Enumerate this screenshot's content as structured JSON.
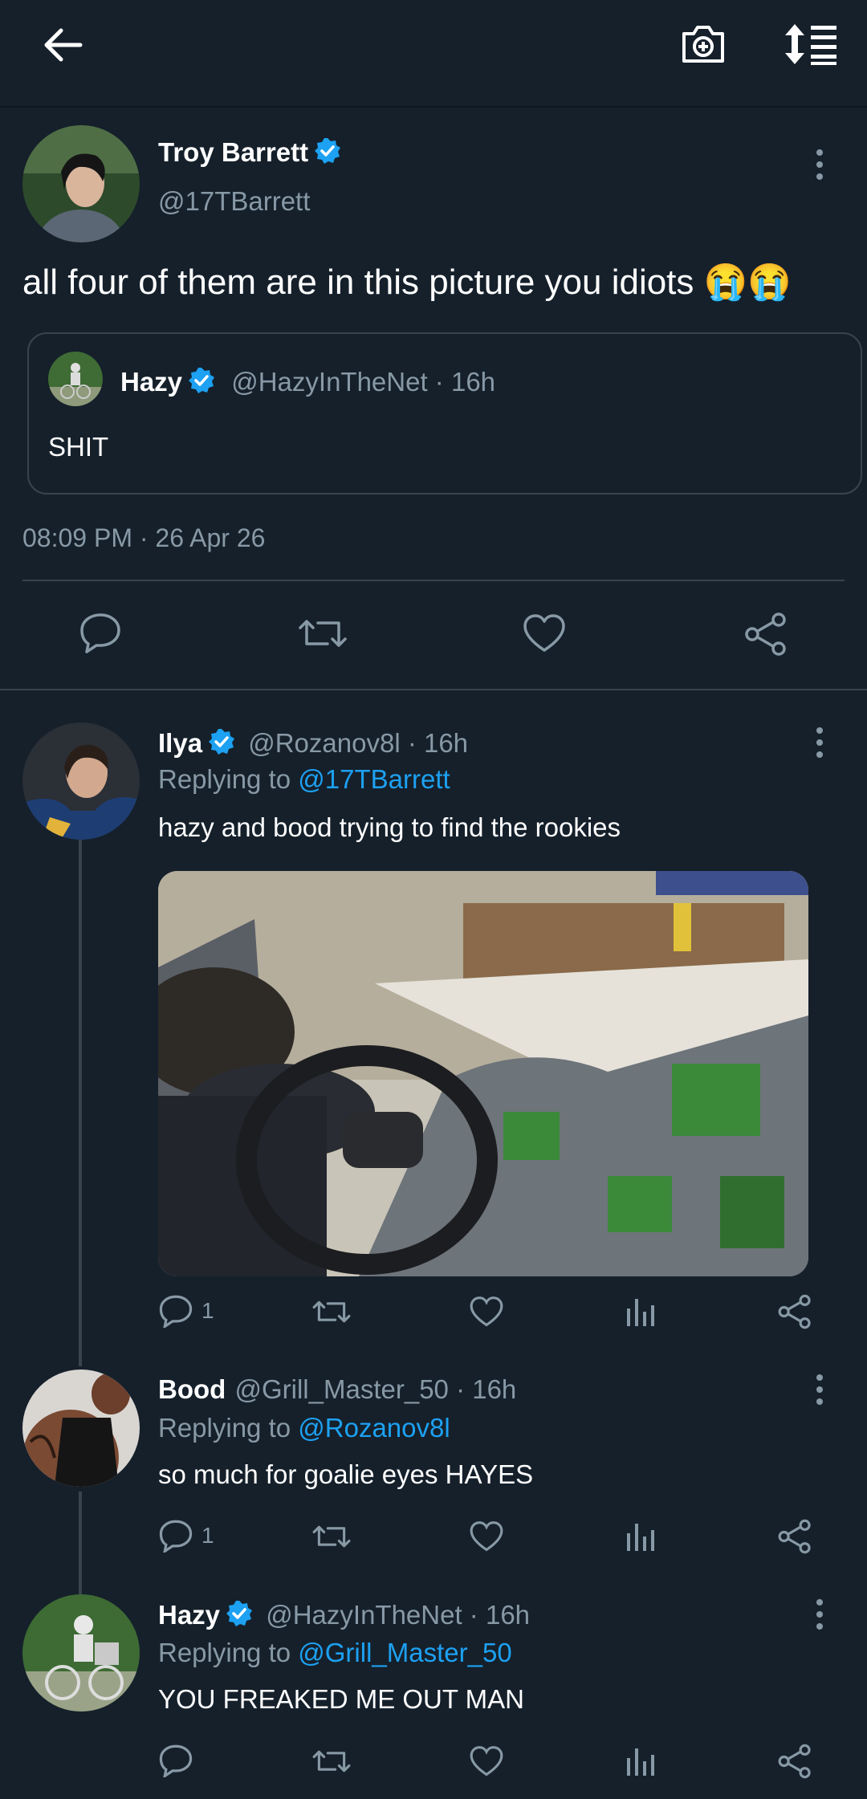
{
  "topbar": {
    "back_icon": "arrow-left-icon",
    "camera_icon": "camera-plus-icon",
    "sort_icon": "sort-list-icon"
  },
  "main_tweet": {
    "author_name": "Troy Barrett",
    "handle": "@17TBarrett",
    "text": "all four of them are in this picture you idiots 😭😭",
    "quote": {
      "author_name": "Hazy",
      "handle_time": "@HazyInTheNet · 16h",
      "text": "SHIT"
    },
    "timestamp": "08:09 PM · 26 Apr 26"
  },
  "replies": [
    {
      "author_name": "Ilya",
      "verified": true,
      "handle_time": "@Rozanov8l · 16h",
      "replying_prefix": "Replying to ",
      "replying_to": "@17TBarrett",
      "text": "hazy and bood trying to find the rookies",
      "reply_count": "1"
    },
    {
      "author_name": "Bood",
      "verified": false,
      "handle_time": "@Grill_Master_50 · 16h",
      "replying_prefix": "Replying to ",
      "replying_to": "@Rozanov8l",
      "text": "so much for goalie eyes HAYES",
      "reply_count": "1"
    },
    {
      "author_name": "Hazy",
      "verified": true,
      "handle_time": "@HazyInTheNet · 16h",
      "replying_prefix": "Replying to ",
      "replying_to": "@Grill_Master_50",
      "text": "YOU FREAKED ME OUT MAN",
      "reply_count": ""
    }
  ],
  "colors": {
    "background": "#15202b",
    "accent": "#1da1f2",
    "muted": "#8899a6",
    "divider": "#38444d"
  }
}
